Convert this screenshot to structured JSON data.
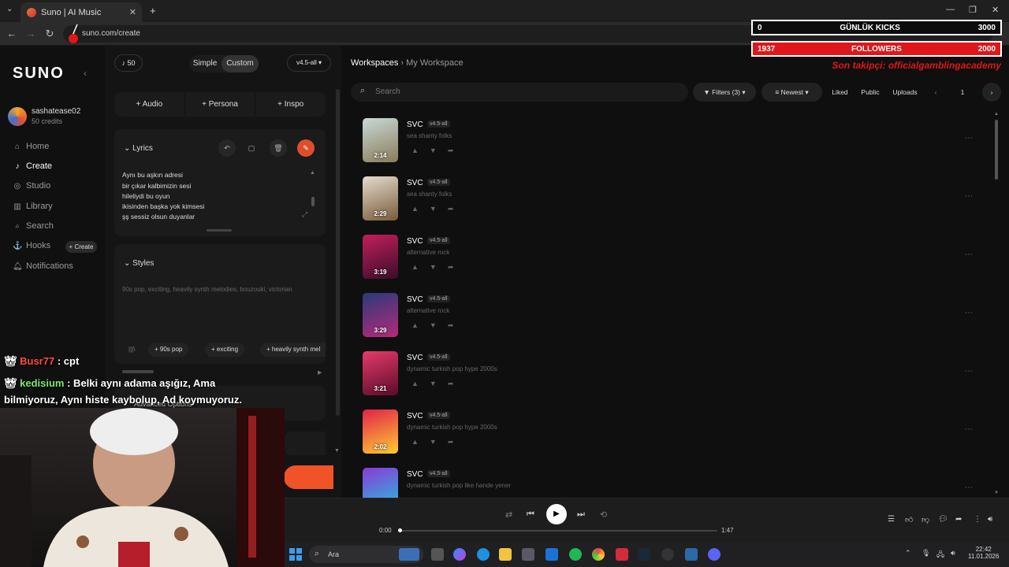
{
  "browser": {
    "tab_title": "Suno | AI Music",
    "url": "suno.com/create"
  },
  "overlay": {
    "kicks_left": "0",
    "kicks_label": "GÜNLÜK KICKS",
    "kicks_right": "3000",
    "followers_left": "1937",
    "followers_label": "FOLLOWERS",
    "followers_right": "2000",
    "last_follower": "Son takipçi: officialgamblingacademy"
  },
  "sidebar": {
    "logo": "SUNO",
    "username": "sashatease02",
    "credits": "50 credits",
    "items": [
      {
        "label": "Home",
        "icon": "home-icon"
      },
      {
        "label": "Create",
        "icon": "music-note-icon"
      },
      {
        "label": "Studio",
        "icon": "studio-icon"
      },
      {
        "label": "Library",
        "icon": "library-icon"
      },
      {
        "label": "Search",
        "icon": "search-icon"
      },
      {
        "label": "Hooks",
        "icon": "hooks-icon"
      },
      {
        "label": "Notifications",
        "icon": "bell-icon"
      }
    ],
    "hooks_create": "+ Create"
  },
  "create": {
    "credits": "50",
    "mode_simple": "Simple",
    "mode_custom": "Custom",
    "model": "v4.5-all",
    "tool_audio": "Audio",
    "tool_persona": "Persona",
    "tool_inspo": "Inspo",
    "lyrics_label": "Lyrics",
    "lyrics": [
      "Aynı bu aşkın adresi",
      "bir çıkar kalbimizin sesi",
      "hileliydi bu oyun",
      "ikisinden başka yok kimsesi",
      "şş sessiz olsun duyanlar"
    ],
    "styles_label": "Styles",
    "styles_placeholder": "90s pop, exciting, heavily synth melodies, bouzouki, victorian",
    "chips": [
      "90s pop",
      "exciting",
      "heavily synth mel"
    ],
    "advanced": "Advanced Options"
  },
  "workspace": {
    "crumb_root": "Workspaces",
    "crumb_current": "My Workspace",
    "search_placeholder": "Search",
    "filters": "Filters (3)",
    "sort": "Newest",
    "liked": "Liked",
    "public": "Public",
    "uploads": "Uploads",
    "page": "1",
    "songs": [
      {
        "title": "SVC",
        "badge": "v4.5-all",
        "style": "sea shanty folks",
        "duration": "2:14",
        "c1": "#c8d9d6",
        "c2": "#8a7b5b"
      },
      {
        "title": "SVC",
        "badge": "v4.5-all",
        "style": "sea shanty folks",
        "duration": "2:29",
        "c1": "#e3dccd",
        "c2": "#7a5a3a"
      },
      {
        "title": "SVC",
        "badge": "v4.5-all",
        "style": "alternative rock",
        "duration": "3:19",
        "c1": "#c21f5a",
        "c2": "#3a0d2a"
      },
      {
        "title": "SVC",
        "badge": "v4.5-all",
        "style": "alternative rock",
        "duration": "3:29",
        "c1": "#2a3a7a",
        "c2": "#b52a7a"
      },
      {
        "title": "SVC",
        "badge": "v4.5-all",
        "style": "dynamic turkish pop hype 2000s",
        "duration": "3:21",
        "c1": "#e63a6a",
        "c2": "#5a0c2a"
      },
      {
        "title": "SVC",
        "badge": "v4.5-all",
        "style": "dynamic turkish pop hype 2000s",
        "duration": "2:02",
        "c1": "#e2224a",
        "c2": "#ffcc33"
      },
      {
        "title": "SVC",
        "badge": "v4.5-all",
        "style": "dynamic turkish pop like hande yener",
        "duration": "",
        "c1": "#8a3bd6",
        "c2": "#23c2e0"
      }
    ]
  },
  "player": {
    "time_current": "0:00",
    "time_total": "1:47"
  },
  "chat": {
    "msg1_user": "Busr77",
    "msg1_text": ": cpt",
    "msg2_user": "kedisium",
    "msg2_text": ": Belki aynı adama aşığız, Ama bilmiyoruz, Aynı histe kaybolup, Ad koymuyoruz."
  },
  "taskbar": {
    "search": "Ara",
    "time": "22:42",
    "date": "11.01.2026"
  },
  "colors": {
    "accent": "#f05327",
    "overlay_red": "#e0161a"
  }
}
